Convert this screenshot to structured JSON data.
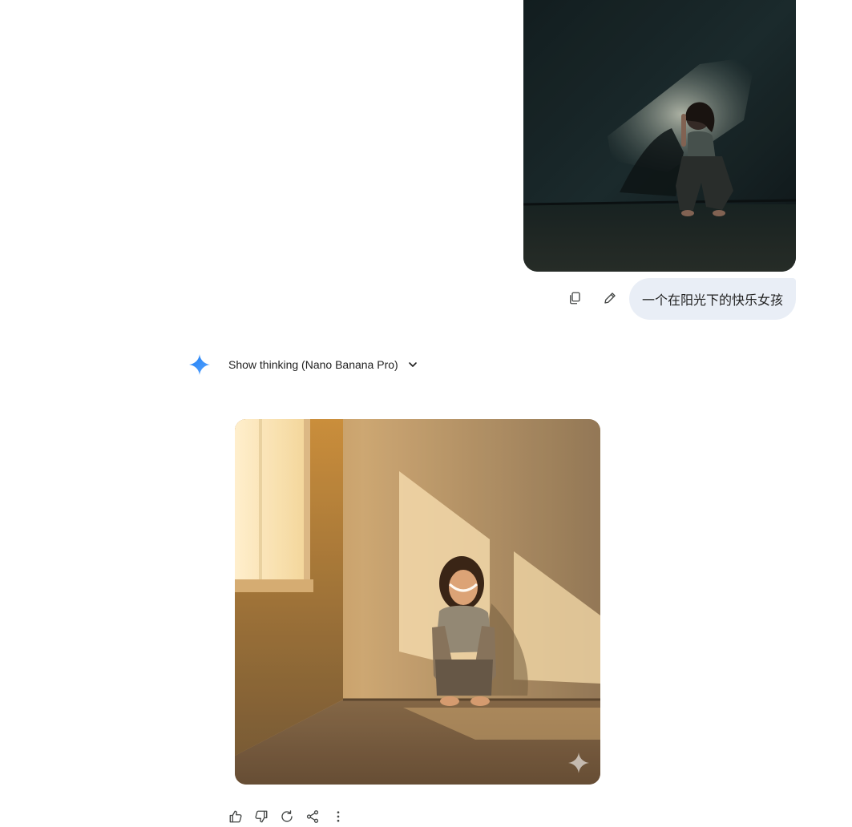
{
  "conversation": {
    "user_message": {
      "image": {
        "alt_icon": "uploaded-image",
        "tone": "dark"
      },
      "prompt_text": "一个在阳光下的快乐女孩",
      "actions": [
        {
          "name": "copy-icon"
        },
        {
          "name": "edit-icon"
        }
      ]
    },
    "response": {
      "model_icon": "gemini-spark-icon",
      "thinking_label": "Show thinking (Nano Banana Pro)",
      "thinking_expanded": false,
      "image": {
        "tone": "warm-sunlight",
        "watermark_icon": "gemini-sparkle-watermark"
      },
      "feedback_actions": [
        {
          "name": "thumbs-up-icon"
        },
        {
          "name": "thumbs-down-icon"
        },
        {
          "name": "regenerate-icon"
        },
        {
          "name": "share-icon"
        },
        {
          "name": "more-options-icon"
        }
      ]
    }
  },
  "colors": {
    "prompt_bubble_bg": "#e9eef6",
    "spark_blue": "#4285f4",
    "icon_gray": "#444746",
    "text": "#1f1f1f"
  }
}
